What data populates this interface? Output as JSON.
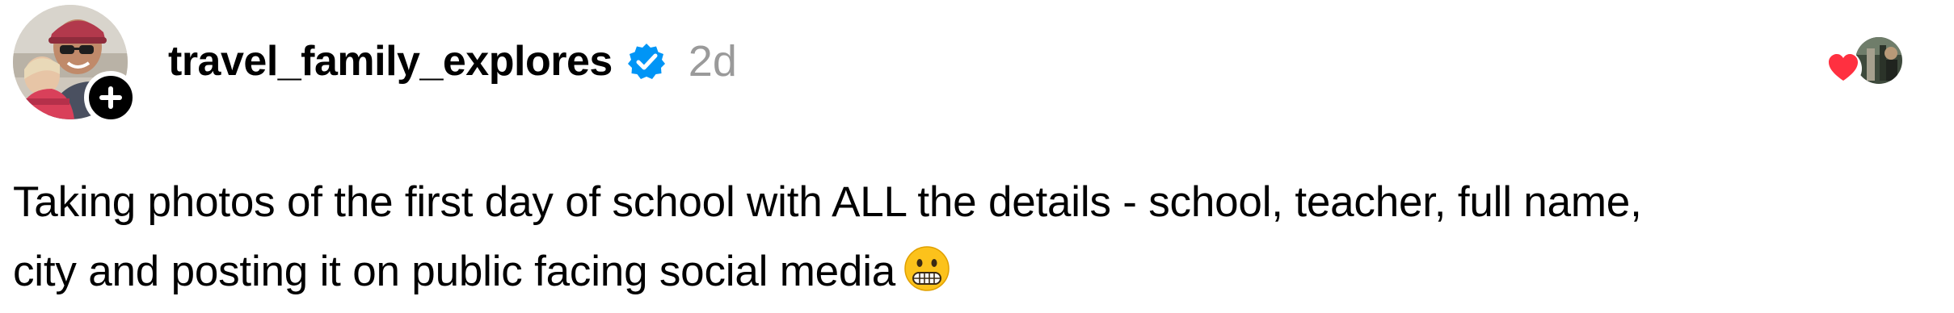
{
  "post": {
    "username": "travel_family_explores",
    "timestamp": "2d",
    "verified": true,
    "body_lines": [
      "Taking photos of the first day of school with ALL the details - school, teacher, full name,",
      "city and posting it on public facing social media"
    ],
    "body_emoji": "grimacing-face-emoji"
  },
  "icons": {
    "follow": "plus-icon",
    "verified": "verified-badge-icon",
    "reaction": "heart-icon"
  },
  "colors": {
    "verified_blue": "#0095f6",
    "heart_red": "#ff3040",
    "timestamp_gray": "#9a9a9a"
  }
}
